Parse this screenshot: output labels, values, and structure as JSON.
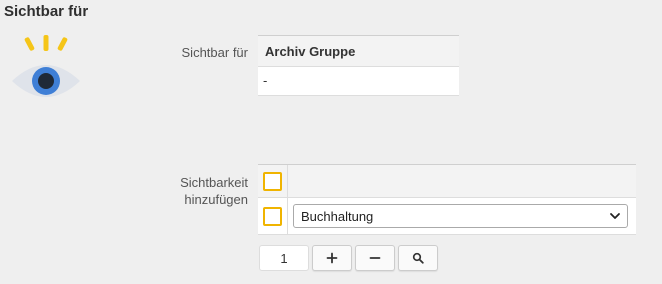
{
  "header": {
    "title": "Sichtbar für",
    "icon": "eye-icon"
  },
  "visibility": {
    "label": "Sichtbar für",
    "column_header": "Archiv Gruppe",
    "rows": [
      "-"
    ]
  },
  "add_visibility": {
    "label": "Sichtbarkeit hinzufügen",
    "select_value": "Buchhaltung",
    "page_value": "1",
    "buttons": [
      "plus-icon",
      "minus-icon",
      "search-icon"
    ]
  },
  "colors": {
    "background": "#efefef",
    "checkbox_border": "#f0b400",
    "eye_ray": "#f5c518",
    "eye_white": "#dfe3ea",
    "eye_iris": "#3f7fd6",
    "eye_pupil": "#1f2937"
  }
}
